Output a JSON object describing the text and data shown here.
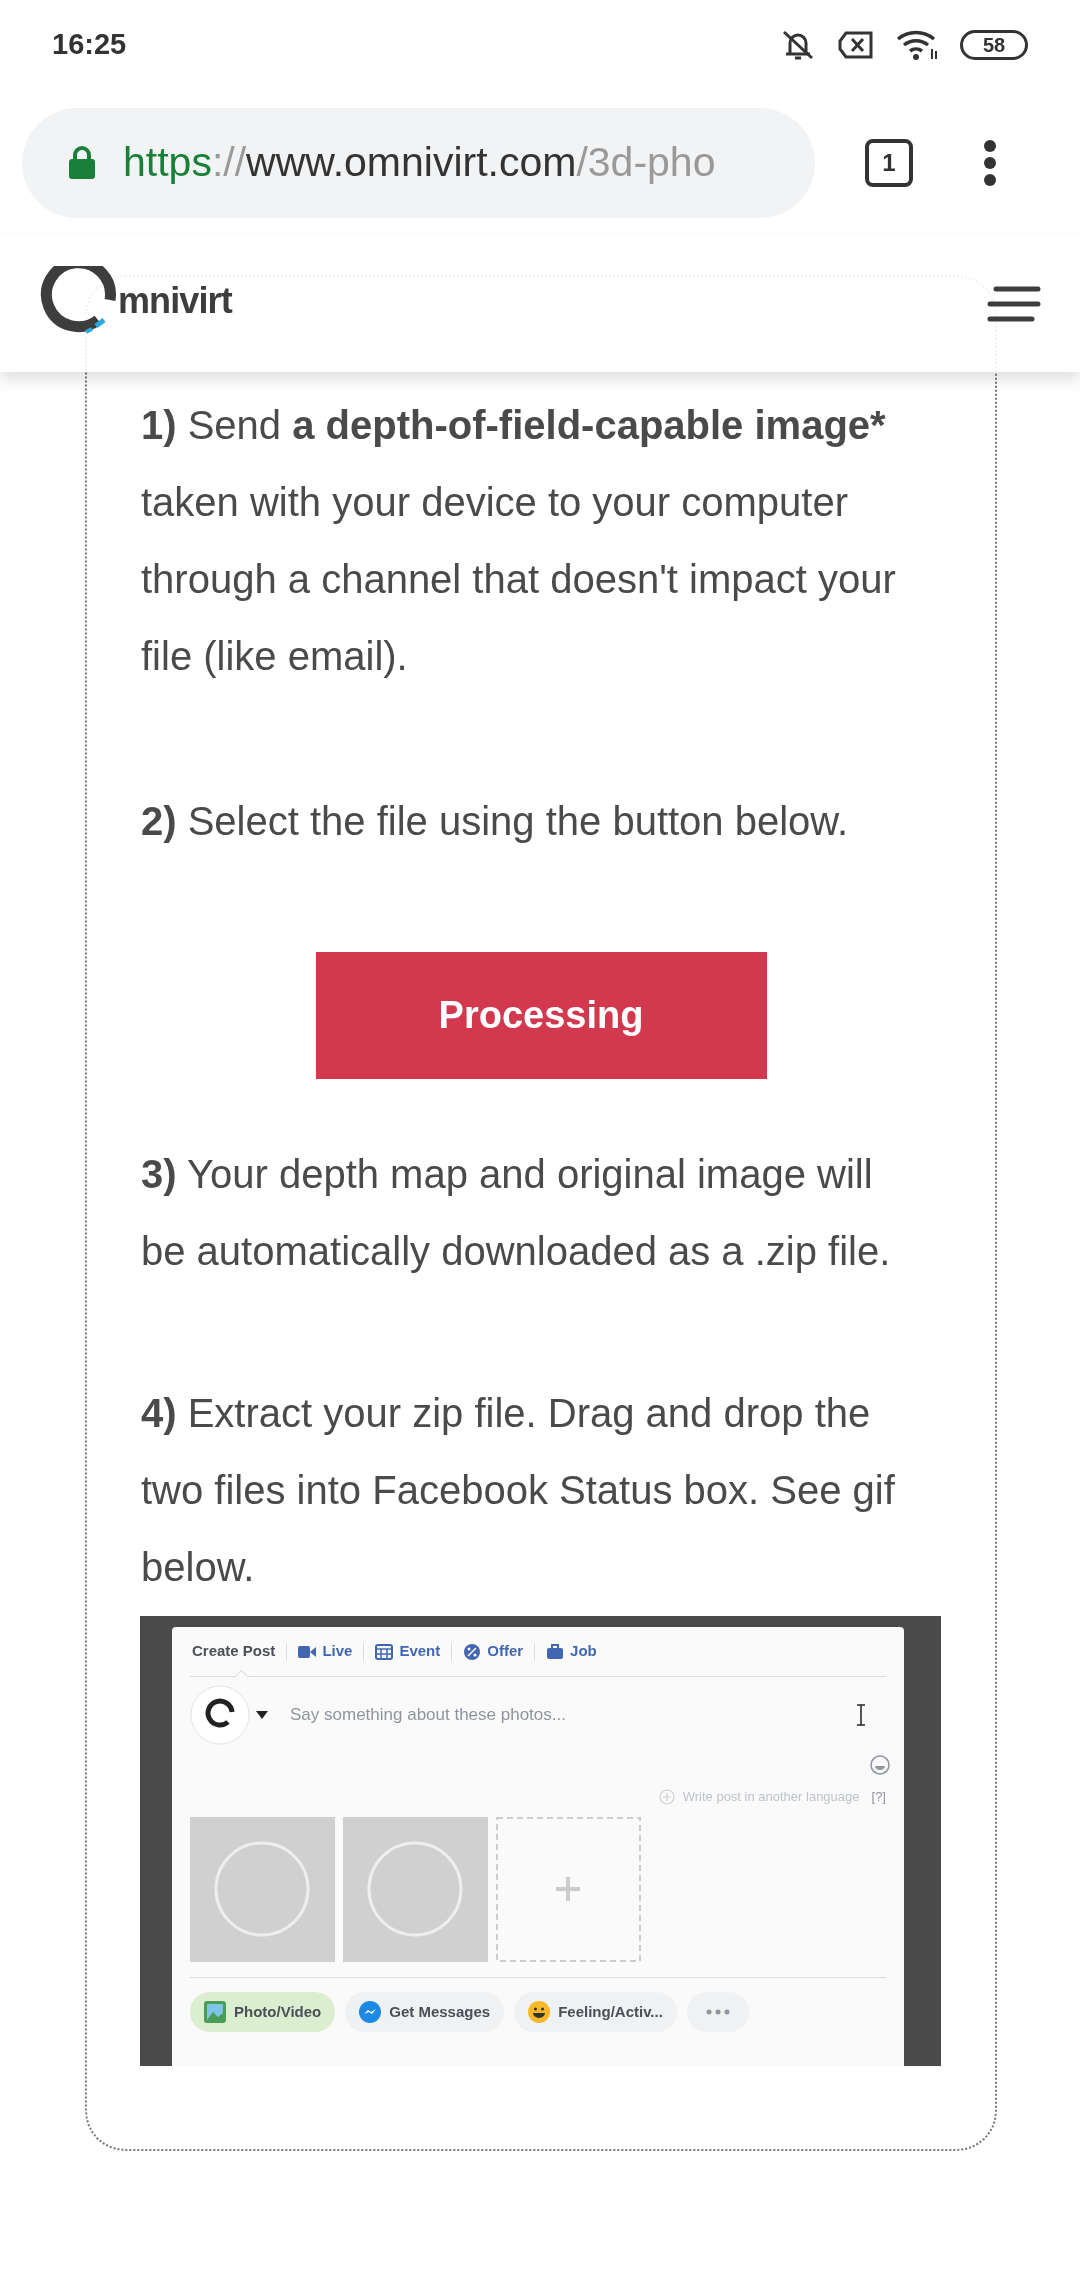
{
  "status_bar": {
    "time": "16:25",
    "battery": "58"
  },
  "browser": {
    "url_scheme": "https",
    "url_separator": "://",
    "url_host": "www.omnivirt.com",
    "url_path": "/3d-pho",
    "tab_count": "1"
  },
  "site_header": {
    "logo_text": "mnivirt"
  },
  "content": [
    {
      "kind": "paragraph",
      "segments": [
        {
          "text": "1)",
          "bold": true
        },
        {
          "text": " Send ",
          "bold": false
        },
        {
          "text": "a depth-of-field-capable image*",
          "bold": true
        },
        {
          "text": " taken with your device to your computer through a channel that doesn't impact your file (like email).",
          "bold": false
        }
      ]
    },
    {
      "kind": "paragraph",
      "segments": [
        {
          "text": "2)",
          "bold": true
        },
        {
          "text": " Select the file using the button below.",
          "bold": false
        }
      ]
    },
    {
      "kind": "button",
      "label": "Processing"
    },
    {
      "kind": "paragraph",
      "segments": [
        {
          "text": "3)",
          "bold": true
        },
        {
          "text": " Your depth map and original image will be automatically downloaded as a .zip file.",
          "bold": false
        }
      ]
    },
    {
      "kind": "paragraph",
      "segments": [
        {
          "text": "4)",
          "bold": true
        },
        {
          "text": " Extract your zip file. Drag and drop the two files into Facebook Status box. See gif below.",
          "bold": false
        }
      ]
    },
    {
      "kind": "composer",
      "tabs": [
        {
          "label": "Create Post",
          "selected": true
        },
        {
          "label": "Live",
          "selected": false
        },
        {
          "label": "Event",
          "selected": false
        },
        {
          "label": "Offer",
          "selected": false
        },
        {
          "label": "Job",
          "selected": false
        }
      ],
      "placeholder": "Say something about these photos...",
      "language_link": "Write post in another language",
      "help": "[?]",
      "actions": [
        {
          "label": "Photo/Video",
          "selected": true
        },
        {
          "label": "Get Messages",
          "selected": false
        },
        {
          "label": "Feeling/Activ...",
          "selected": false
        }
      ]
    }
  ]
}
